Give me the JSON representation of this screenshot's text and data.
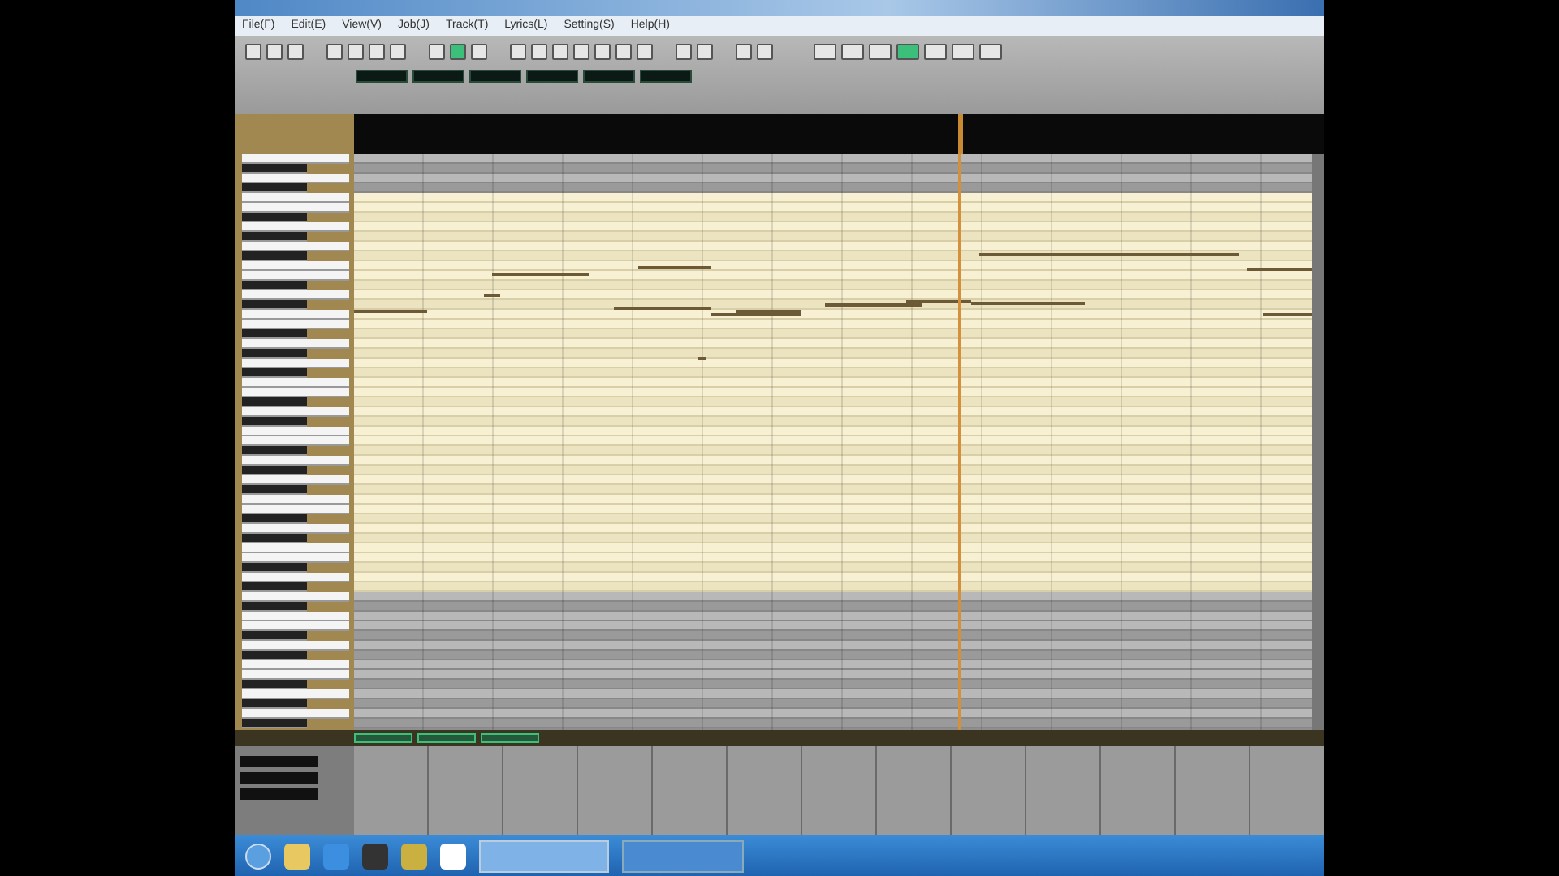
{
  "menu": [
    {
      "label": "File(F)"
    },
    {
      "label": "Edit(E)"
    },
    {
      "label": "View(V)"
    },
    {
      "label": "Job(J)"
    },
    {
      "label": "Track(T)"
    },
    {
      "label": "Lyrics(L)"
    },
    {
      "label": "Setting(S)"
    },
    {
      "label": "Help(H)"
    }
  ],
  "tools": [
    {
      "selected": false
    },
    {
      "selected": true
    },
    {
      "selected": false
    }
  ],
  "transport": [
    {
      "selected": false
    },
    {
      "selected": false
    },
    {
      "selected": false
    },
    {
      "selected": true
    },
    {
      "selected": false
    },
    {
      "selected": false
    },
    {
      "selected": false
    }
  ]
}
